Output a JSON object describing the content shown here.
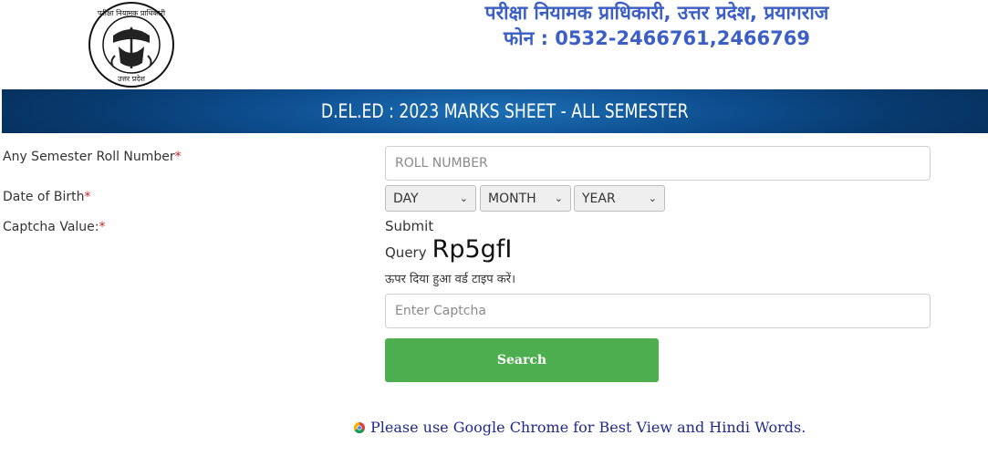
{
  "header": {
    "logo_top_text": "परीक्षा नियामक प्राधिकारी",
    "logo_bottom_text": "उत्तर प्रदेश",
    "title": "परीक्षा नियामक प्राधिकारी, उत्तर प्रदेश, प्रयागराज",
    "phone": "फोन : 0532-2466761,2466769"
  },
  "banner": {
    "text": "D.EL.ED : 2023 MARKS SHEET - ALL SEMESTER",
    "color": "#0d4d8e"
  },
  "form": {
    "roll_label": "Any Semester Roll Number",
    "roll_placeholder": "ROLL NUMBER",
    "dob_label": "Date of Birth",
    "day_selected": "DAY",
    "month_selected": "MONTH",
    "year_selected": "YEAR",
    "captcha_label": "Captcha Value:",
    "required_mark": "*",
    "submit_text": "Submit",
    "query_text": "Query",
    "captcha_value": "Rp5gfI",
    "captcha_hint": "ऊपर दिया हुआ वर्ड टाइप करें।",
    "captcha_placeholder": "Enter Captcha",
    "search_label": "Search",
    "button_color": "#4cae4f"
  },
  "footer": {
    "note": "Please use Google Chrome for Best View and Hindi Words.",
    "icon": "chrome-icon"
  }
}
